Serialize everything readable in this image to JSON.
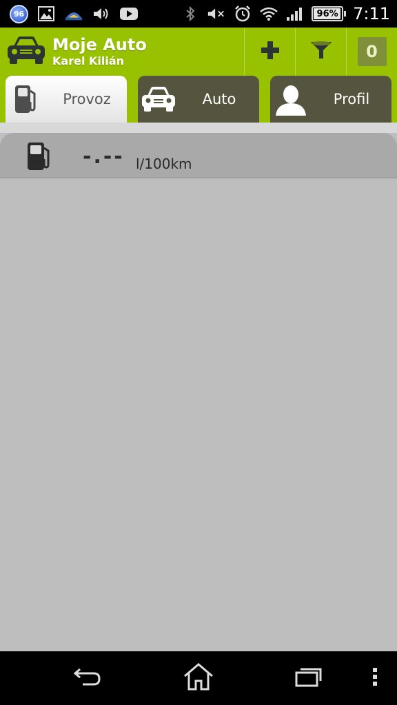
{
  "status_bar": {
    "notification_count": "96",
    "battery_percent": "96%",
    "time": "7:11",
    "icons": [
      "notification-badge-icon",
      "gallery-icon",
      "weather-icon",
      "volume-icon",
      "youtube-icon",
      "bluetooth-icon",
      "mute-icon",
      "alarm-icon",
      "wifi-icon",
      "signal-icon",
      "battery-icon"
    ]
  },
  "header": {
    "title": "Moje Auto",
    "user": "Karel Kilián",
    "counter": "0",
    "icons": [
      "car-logo-icon",
      "plus-icon",
      "filter-icon"
    ]
  },
  "tabs": [
    {
      "label": "Provoz",
      "icon": "fuel-pump-icon",
      "active": true
    },
    {
      "label": "Auto",
      "icon": "car-icon",
      "active": false
    },
    {
      "label": "Profil",
      "icon": "person-icon",
      "active": false
    }
  ],
  "consumption": {
    "value": "-.--",
    "unit": "l/100km",
    "icon": "fuel-pump-icon"
  },
  "colors": {
    "header_green": "#98c100",
    "tab_inactive": "#55553f",
    "content_bg": "#bebebe",
    "row_bg": "#a9a9a9"
  }
}
